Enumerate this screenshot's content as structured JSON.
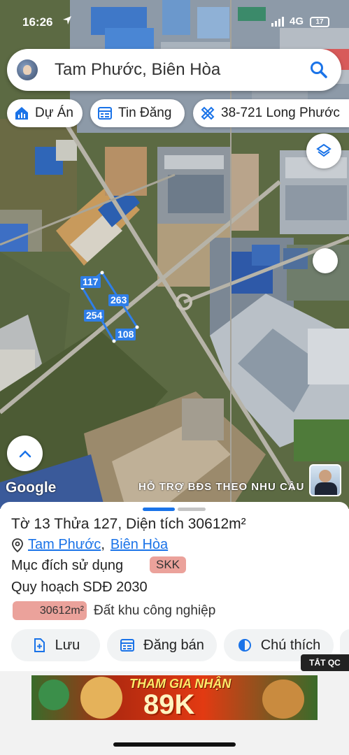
{
  "status_bar": {
    "time": "16:26",
    "network": "4G",
    "battery": "17"
  },
  "search": {
    "query": "Tam Phước, Biên Hòa"
  },
  "chips": [
    {
      "label": "Dự Án",
      "icon": "home-chart-icon"
    },
    {
      "label": "Tin Đăng",
      "icon": "listing-icon"
    },
    {
      "label": "38-721 Long Phước",
      "icon": "ruler-pencil-icon"
    }
  ],
  "map": {
    "lot_edge_lengths": [
      "117",
      "263",
      "254",
      "108"
    ],
    "attribution": "Google",
    "ad_caption": "HỖ TRỢ BĐS  THEO NHU CẦU"
  },
  "parcel": {
    "title": "Tờ 13 Thửa 127, Diện tích 30612m²",
    "ward": "Tam Phước",
    "separator": ",",
    "city": "Biên Hòa",
    "usage_label": "Mục đích sử dụng",
    "usage_code": "SKK",
    "planning_label": "Quy hoạch SDĐ 2030",
    "planning_area": "30612m²",
    "planning_type": "Đất khu công nghiệp"
  },
  "actions": [
    {
      "label": "Lưu",
      "icon": "add-document-icon"
    },
    {
      "label": "Đăng bán",
      "icon": "calendar-list-icon"
    },
    {
      "label": "Chú thích",
      "icon": "half-circle-icon"
    }
  ],
  "ads": {
    "close_label": "TẮT QC",
    "banner_line1": "THAM GIA NHẬN",
    "banner_line2": "89K"
  },
  "colors": {
    "accent": "#1a73e8",
    "lot_outline": "#2f7ee8",
    "usage_badge": "#eba29b"
  }
}
